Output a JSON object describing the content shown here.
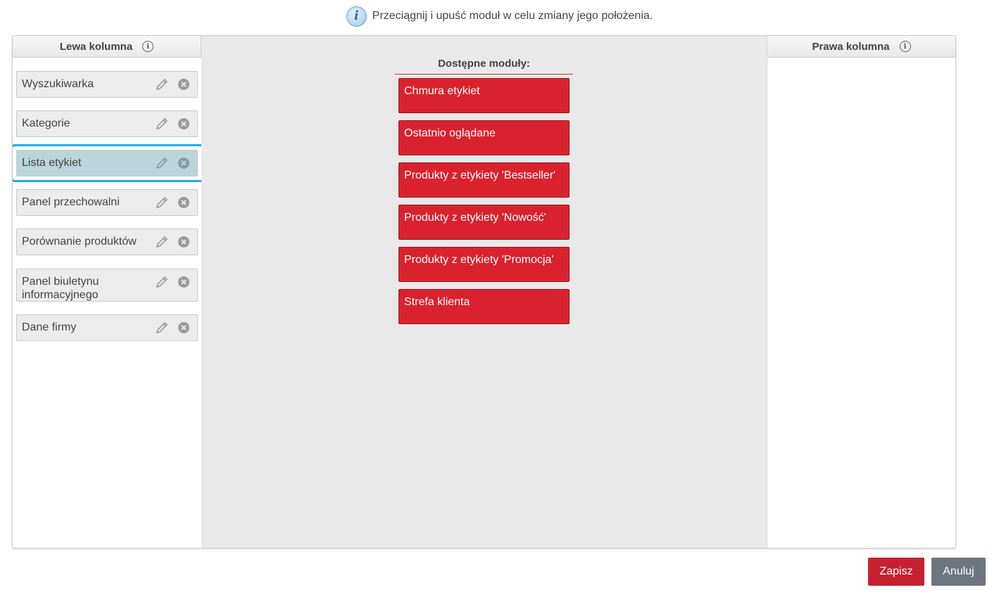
{
  "notice": {
    "icon": "info-icon",
    "text": "Przeciągnij i upuść moduł w celu zmiany jego położenia."
  },
  "left_column": {
    "title": "Lewa kolumna",
    "modules": [
      {
        "label": "Wyszukiwarka",
        "selected": false
      },
      {
        "label": "Kategorie",
        "selected": false
      },
      {
        "label": "Lista etykiet",
        "selected": true
      },
      {
        "label": "Panel przechowalni",
        "selected": false
      },
      {
        "label": "Porównanie produktów",
        "selected": false
      },
      {
        "label": "Panel biuletynu informacyjnego",
        "selected": false
      },
      {
        "label": "Dane firmy",
        "selected": false
      }
    ]
  },
  "available": {
    "title": "Dostępne moduły:",
    "modules": [
      "Chmura etykiet",
      "Ostatnio oglądane",
      "Produkty z etykiety 'Bestseller'",
      "Produkty z etykiety 'Nowość'",
      "Produkty z etykiety 'Promocja'",
      "Strefa klienta"
    ]
  },
  "right_column": {
    "title": "Prawa kolumna"
  },
  "buttons": {
    "save": "Zapisz",
    "cancel": "Anuluj"
  },
  "colors": {
    "accent_red": "#d9222e",
    "save_button": "#c62130",
    "cancel_button": "#6c7680",
    "selection_ring": "#29a9e0",
    "selected_module": "#b9d5db"
  }
}
